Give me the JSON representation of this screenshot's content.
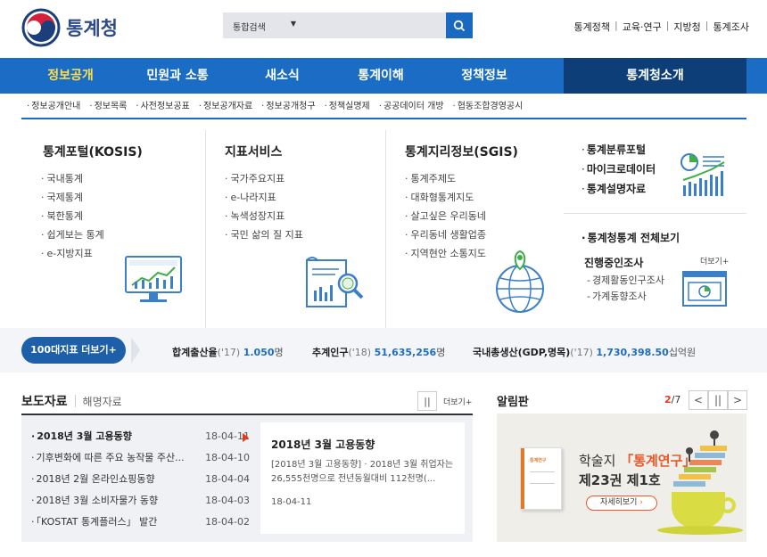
{
  "header": {
    "logo_text": "통계청",
    "search_select": "통합검색",
    "top_links": [
      "통계정책",
      "교육·연구",
      "지방청",
      "통계조사"
    ]
  },
  "gnb": {
    "items": [
      "정보공개",
      "민원과 소통",
      "새소식",
      "통계이해",
      "정책정보"
    ],
    "right": "통계청소개"
  },
  "submenu": [
    "정보공개안내",
    "정보목록",
    "사전정보공표",
    "정보공개자료",
    "정보공개청구",
    "정책실명제",
    "공공데이터 개방",
    "협동조합경영공시"
  ],
  "columns": [
    {
      "title": "통계포털(KOSIS)",
      "items": [
        "국내통계",
        "국제통계",
        "북한통계",
        "쉽게보는 통계",
        "e-지방지표"
      ]
    },
    {
      "title": "지표서비스",
      "items": [
        "국가주요지표",
        "e-나라지표",
        "녹색성장지표",
        "국민 삶의 질 지표"
      ]
    },
    {
      "title": "통계지리정보(SGIS)",
      "items": [
        "통계주제도",
        "대화형통계지도",
        "살고싶은 우리동네",
        "우리동네 생활업종",
        "지역현안 소통지도"
      ]
    }
  ],
  "right_panel": {
    "links": [
      "통계분류포털",
      "마이크로데이터",
      "통계설명자료"
    ],
    "all_stats": "통계청통계 전체보기",
    "ongoing_title": "진행중인조사",
    "more": "더보기+",
    "ongoing": [
      "경제활동인구조사",
      "가계동향조사"
    ]
  },
  "indicators": {
    "button": "100대지표 더보기+",
    "items": [
      {
        "label": "합계출산율",
        "year": "('17)",
        "value": "1.050",
        "unit": "명"
      },
      {
        "label": "추계인구",
        "year": "('18)",
        "value": "51,635,256",
        "unit": "명"
      },
      {
        "label": "국내총생산(GDP,명목)",
        "year": "('17)",
        "value": "1,730,398.50",
        "unit": "십억원"
      }
    ]
  },
  "press": {
    "tab_active": "보도자료",
    "tab_inactive": "해명자료",
    "pause": "||",
    "more": "더보기+",
    "items": [
      {
        "title": "2018년 3월 고용동향",
        "date": "18-04-11"
      },
      {
        "title": "기후변화에 따른 주요 농작물 주산...",
        "date": "18-04-10"
      },
      {
        "title": "2018년 2월 온라인쇼핑동향",
        "date": "18-04-04"
      },
      {
        "title": "2018년 3월 소비자물가 동향",
        "date": "18-04-03"
      },
      {
        "title": "「KOSTAT 통계플러스」 발간",
        "date": "18-04-02"
      }
    ],
    "detail": {
      "title": "2018년 3월 고용동향",
      "body": "[2018년 3월 고용동향] · 2018년 3월 취업자는 26,555천명으로 전년동월대비 112천명(...",
      "date": "18-04-11"
    }
  },
  "notice": {
    "title": "알림판",
    "page_current": "2",
    "page_total": "/7",
    "prev": "<",
    "pause": "||",
    "next": ">",
    "banner_line1_pre": "학술지",
    "banner_line1_hl": "「통계연구」",
    "banner_line2": "제23권 제1호",
    "banner_button": "자세히보기",
    "book_title": "통계연구"
  }
}
